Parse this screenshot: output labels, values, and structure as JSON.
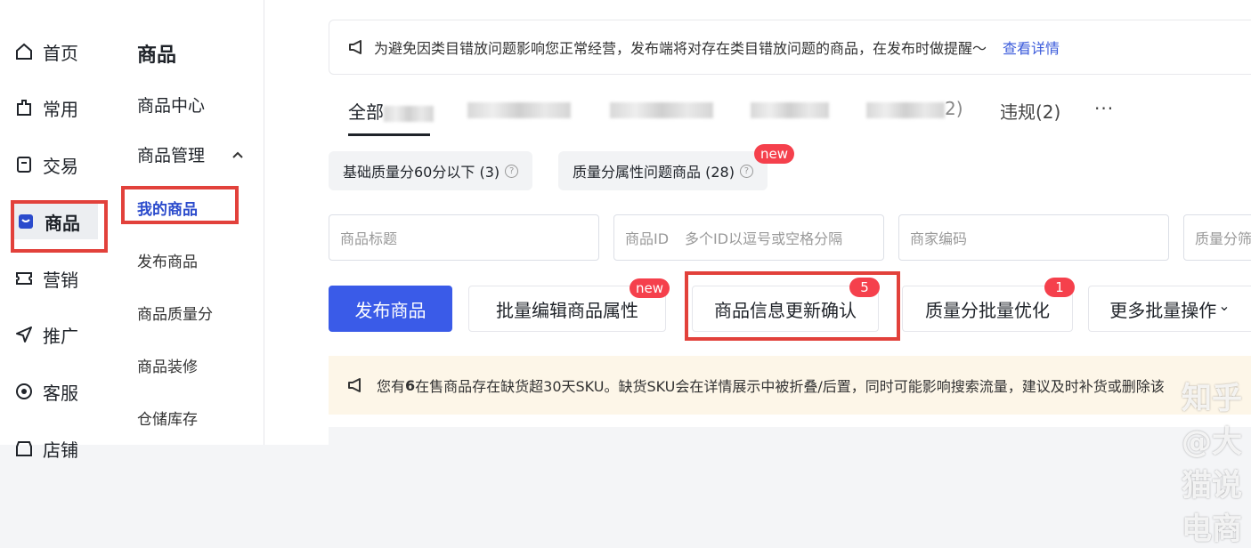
{
  "sidebar": {
    "items": [
      {
        "label": "首页",
        "icon": "home-icon"
      },
      {
        "label": "常用",
        "icon": "bookmark-icon"
      },
      {
        "label": "交易",
        "icon": "order-icon"
      },
      {
        "label": "商品",
        "icon": "product-icon"
      },
      {
        "label": "营销",
        "icon": "ticket-icon"
      },
      {
        "label": "推广",
        "icon": "send-icon"
      },
      {
        "label": "客服",
        "icon": "chat-icon"
      },
      {
        "label": "店铺",
        "icon": "store-icon"
      }
    ]
  },
  "subnav": {
    "title": "商品",
    "items": [
      {
        "label": "商品中心"
      },
      {
        "label": "商品管理"
      }
    ],
    "leaves": [
      {
        "label": "我的商品"
      },
      {
        "label": "发布商品"
      },
      {
        "label": "商品质量分"
      },
      {
        "label": "商品装修"
      },
      {
        "label": "仓储库存"
      }
    ]
  },
  "notice": {
    "text": "为避免因类目错放问题影响您正常经营，发布端将对存在类目错放问题的商品，在发布时做提醒～",
    "link": "查看详情"
  },
  "tabs": {
    "all_prefix": "全部",
    "t5_suffix": "2)",
    "violation": "违规(2)",
    "more": "···"
  },
  "chips": [
    {
      "label": "基础质量分60分以下 (3)"
    },
    {
      "label": "质量分属性问题商品 (28)",
      "badge": "new"
    }
  ],
  "filters": {
    "title_placeholder": "商品标题",
    "id_label": "商品ID",
    "id_placeholder": "多个ID以逗号或空格分隔",
    "code_placeholder": "商家编码",
    "quality_placeholder": "质量分筛"
  },
  "buttons": {
    "publish": "发布商品",
    "batch_edit": "批量编辑商品属性",
    "batch_edit_badge": "new",
    "info_confirm": "商品信息更新确认",
    "info_confirm_badge": "5",
    "quality_opt": "质量分批量优化",
    "quality_opt_badge": "1",
    "more_ops": "更多批量操作",
    "more_ops_arrow": "⌄"
  },
  "warning": {
    "prefix": "您有 ",
    "count": "6",
    "text": " 在售商品存在缺货超30天SKU。缺货SKU会在详情展示中被折叠/后置，同时可能影响搜索流量，建议及时补货或删除该"
  },
  "watermark": "知乎 @大猫说电商",
  "colors": {
    "accent": "#3a5be8",
    "highlight_red": "#e2413b",
    "badge_red": "#f5404c",
    "active_link": "#2b4bcc"
  }
}
